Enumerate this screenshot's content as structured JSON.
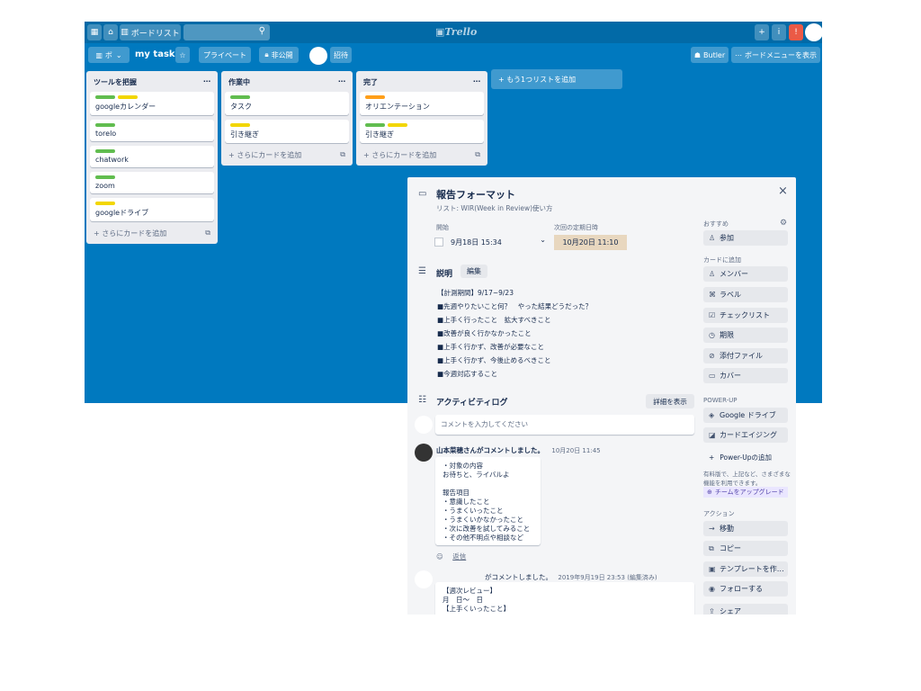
{
  "topbar": {
    "home_label": "⌂",
    "boards_label": "ボードリスト",
    "logo": "Trello",
    "add_label": "+",
    "info_label": "i",
    "notify_label": "!"
  },
  "boardbar": {
    "board_menu": "ボ",
    "title": "my task",
    "star": "☆",
    "visibility": "プライベート",
    "private_label": "非公開",
    "invite": "招待",
    "butler": "Butler",
    "menu": "ボードメニューを表示"
  },
  "lists": [
    {
      "title": "ツールを把握",
      "cards": [
        {
          "labels": [
            "#61bd4f",
            "#f2d600"
          ],
          "text": "googleカレンダー"
        },
        {
          "labels": [
            "#61bd4f"
          ],
          "text": "torelo"
        },
        {
          "labels": [
            "#61bd4f"
          ],
          "text": "chatwork"
        },
        {
          "labels": [
            "#61bd4f"
          ],
          "text": "zoom"
        },
        {
          "labels": [
            "#f2d600"
          ],
          "text": "googleドライブ"
        }
      ],
      "add": "+ さらにカードを追加"
    },
    {
      "title": "作業中",
      "cards": [
        {
          "labels": [
            "#61bd4f"
          ],
          "text": "タスク"
        },
        {
          "labels": [
            "#f2d600"
          ],
          "text": "引き継ぎ"
        }
      ],
      "add": "+ さらにカードを追加"
    },
    {
      "title": "完了",
      "cards": [
        {
          "labels": [
            "#ff9f1a"
          ],
          "text": "オリエンテーション"
        },
        {
          "labels": [
            "#61bd4f",
            "#f2d600"
          ],
          "text": "引き継ぎ"
        }
      ],
      "add": "+ さらにカードを追加"
    }
  ],
  "add_list": "+ もう1つリストを追加",
  "modal": {
    "title": "報告フォーマット",
    "list_ref": "リスト: WIR(Week in Review)使い方",
    "close": "×",
    "start_label": "開始",
    "start_value": "9月18日 15:34",
    "due_label": "次回の定期日時",
    "due_value": "10月20日 11:10",
    "desc_title": "説明",
    "edit_label": "編集",
    "desc_lines": [
      "【計測期間】9/17~9/23",
      "■先週やりたいこと何？　やった結果どうだった？",
      "■上手く行ったこと　拡大すべきこと",
      "■改善が良く行かなかったこと",
      "■上手く行かず、改善が必要なこと",
      "■上手く行かず、今後止めるべきこと",
      "■今週対応すること"
    ],
    "activity_title": "アクティビティログ",
    "activity_btn": "詳細を表示",
    "comment_placeholder": "コメントを入力してください",
    "comment1_header": "山本菜穂さんがコメントしました。",
    "comment1_time": "10月20日 11:45",
    "comment1_lines": [
      "・対象の内容",
      "お待ちと、ライバルよ",
      "",
      "報告項目",
      "・意識したこと",
      "・うまくいったこと",
      "・うまくいかなかったこと",
      "・次に改善を試してみること",
      "・その他不明点や相談など"
    ],
    "reply": "返信",
    "comment2_header": "がコメントしました。",
    "comment2_time": "2019年9月19日 23:53 (編集済み)",
    "comment2_lines": [
      "【週次レビュー】",
      "月　日〜　日",
      "【上手くいったこと】"
    ],
    "side": {
      "suggest_label": "おすすめ",
      "join": "参加",
      "add_to_card": "カードに追加",
      "members": "メンバー",
      "labels": "ラベル",
      "checklist": "チェックリスト",
      "dates": "期限",
      "attachment": "添付ファイル",
      "cover": "カバー",
      "powerups_label": "POWER-UP",
      "gdrive": "Google ドライブ",
      "card_aging": "カードエイジング",
      "add_powerup": "Power-Upの追加",
      "upgrade_note_1": "有料版で、上記など、さまざまな",
      "upgrade_note_2": "機能を利用できます。",
      "upgrade": "チームをアップグレード",
      "actions_label": "アクション",
      "move": "移動",
      "copy": "コピー",
      "template": "テンプレートを作…",
      "follow": "フォローする",
      "share": "シェア"
    }
  }
}
